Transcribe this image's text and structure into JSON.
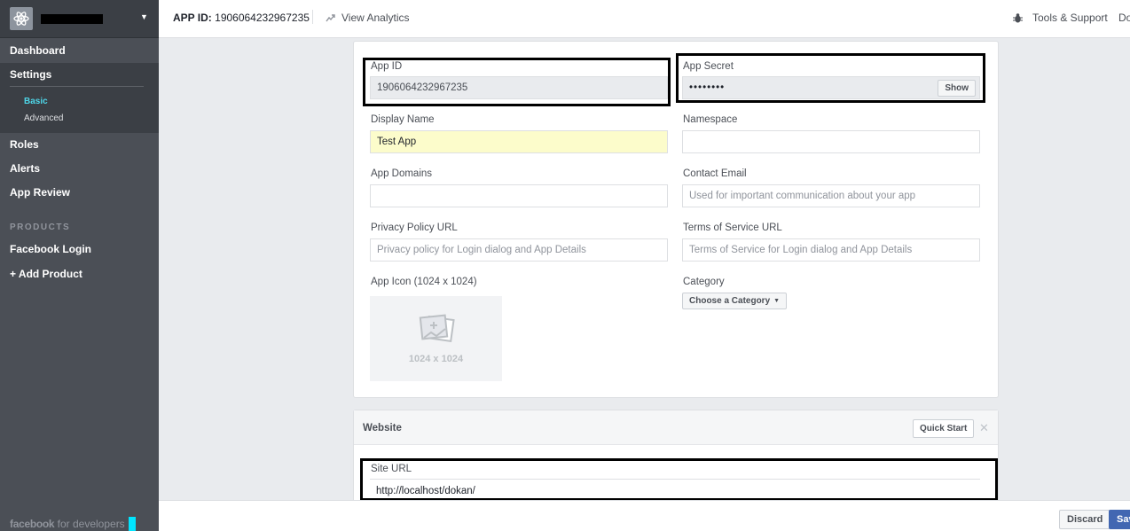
{
  "topbar": {
    "app_id_label": "APP ID:",
    "app_id_value": "1906064232967235",
    "view_analytics": "View Analytics",
    "tools_support": "Tools & Support",
    "docs": "Do"
  },
  "sidebar": {
    "items": [
      {
        "label": "Dashboard"
      },
      {
        "label": "Settings"
      },
      {
        "label": "Roles"
      },
      {
        "label": "Alerts"
      },
      {
        "label": "App Review"
      }
    ],
    "settings_sub": [
      {
        "label": "Basic",
        "active": true
      },
      {
        "label": "Advanced",
        "active": false
      }
    ],
    "products_heading": "PRODUCTS",
    "products": [
      {
        "label": "Facebook Login"
      },
      {
        "label": "+ Add Product"
      }
    ],
    "footer_brand": "facebook",
    "footer_suffix": "for developers"
  },
  "basic_settings": {
    "app_id": {
      "label": "App ID",
      "value": "1906064232967235"
    },
    "app_secret": {
      "label": "App Secret",
      "value": "••••••••",
      "show_label": "Show"
    },
    "display_name": {
      "label": "Display Name",
      "value": "Test App"
    },
    "namespace": {
      "label": "Namespace",
      "value": ""
    },
    "app_domains": {
      "label": "App Domains",
      "value": ""
    },
    "contact_email": {
      "label": "Contact Email",
      "placeholder": "Used for important communication about your app"
    },
    "privacy_policy": {
      "label": "Privacy Policy URL",
      "placeholder": "Privacy policy for Login dialog and App Details"
    },
    "terms_of_service": {
      "label": "Terms of Service URL",
      "placeholder": "Terms of Service for Login dialog and App Details"
    },
    "app_icon": {
      "label": "App Icon (1024 x 1024)",
      "dimension_text": "1024 x 1024"
    },
    "category": {
      "label": "Category",
      "button_label": "Choose a Category"
    }
  },
  "website": {
    "title": "Website",
    "quick_start_label": "Quick Start",
    "close_glyph": "✕",
    "site_url": {
      "label": "Site URL",
      "value": "http://localhost/dokan/"
    }
  },
  "bottombar": {
    "discard_label": "Discard",
    "save_label": "Sav"
  },
  "colors": {
    "sidebar_bg": "#4b4f56",
    "active_sub": "#4ed6e8",
    "primary_button": "#4267b2",
    "highlight_input": "#fcfccb"
  }
}
